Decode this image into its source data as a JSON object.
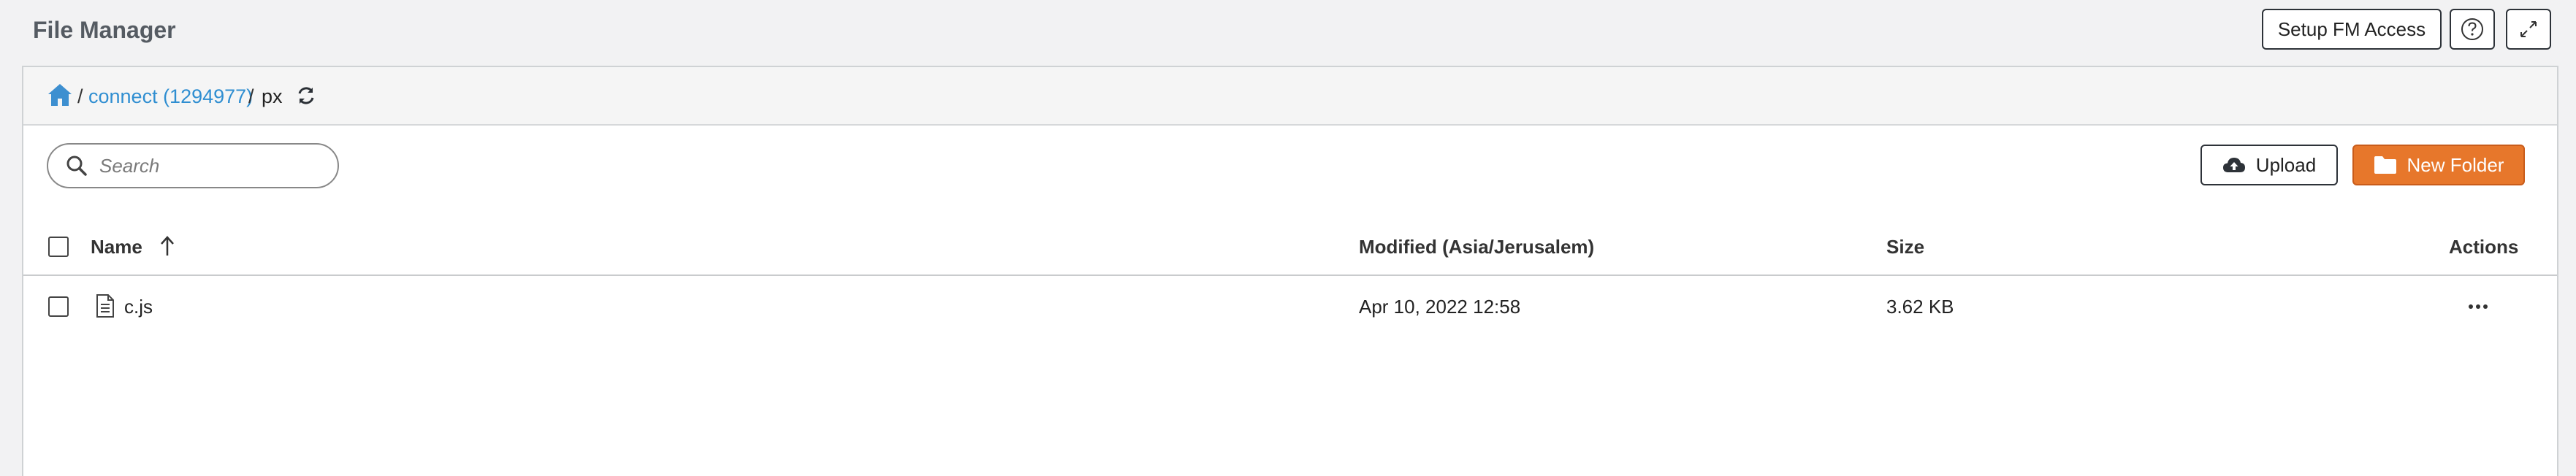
{
  "header": {
    "title": "File Manager",
    "setup_label": "Setup FM Access",
    "help_icon": "question-circle-icon",
    "expand_icon": "expand-icon"
  },
  "breadcrumb": {
    "home_icon": "home-icon",
    "separator": "/",
    "items": [
      {
        "label": "connect (1294977)",
        "link": true
      },
      {
        "label": "px",
        "link": false
      }
    ],
    "refresh_icon": "refresh-icon"
  },
  "toolbar": {
    "search_placeholder": "Search",
    "upload_label": "Upload",
    "new_folder_label": "New Folder"
  },
  "table": {
    "columns": {
      "name": "Name",
      "modified": "Modified (Asia/Jerusalem)",
      "size": "Size",
      "actions": "Actions"
    },
    "sort": {
      "column": "name",
      "direction": "ascending"
    },
    "rows": [
      {
        "name": "c.js",
        "modified": "Apr 10, 2022 12:58",
        "size": "3.62 KB",
        "icon": "file-text-icon"
      }
    ]
  },
  "colors": {
    "accent_link": "#2f8ed1",
    "primary_button": "#e7772b",
    "home_icon": "#3d8fd0"
  }
}
